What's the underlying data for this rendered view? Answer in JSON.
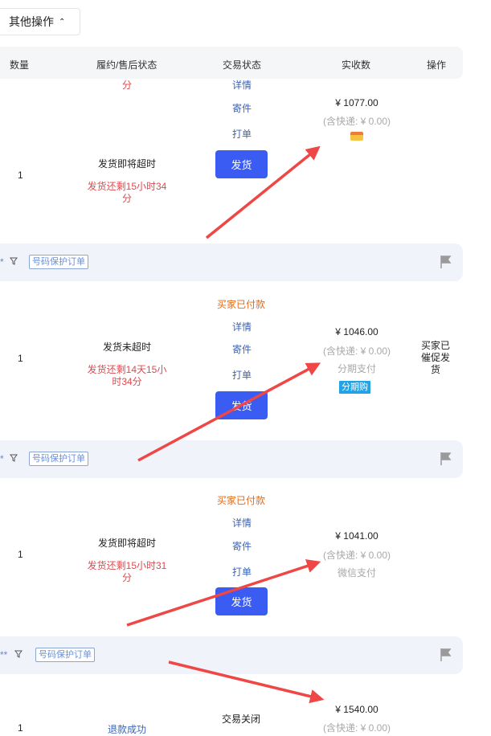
{
  "toolbar": {
    "other_ops_label": "其他操作",
    "caret": "⌃"
  },
  "table_header": {
    "quantity": "数量",
    "fulfillment_status": "履约/售后状态",
    "trade_status": "交易状态",
    "paid_amount": "实收数",
    "actions": "操作"
  },
  "links": {
    "detail": "详情",
    "send": "寄件",
    "print": "打单"
  },
  "ship_label": "发货",
  "order1": {
    "top_fragment": "分",
    "quantity": "1",
    "timeout_status": "发货即将超时",
    "remaining_line1": "发货还剩15小时34",
    "remaining_line2": "分",
    "price": "¥ 1077.00",
    "shipping_note": "(含快递: ¥ 0.00)"
  },
  "separator": {
    "star": "*",
    "tag": "号码保护订单",
    "star_double": "**"
  },
  "order2": {
    "buyer_paid": "买家已付款",
    "quantity": "1",
    "timeout_status": "发货未超时",
    "remaining_line1": "发货还剩14天15小",
    "remaining_line2": "时34分",
    "price": "¥ 1046.00",
    "shipping_note": "(含快递: ¥ 0.00)",
    "payment_method": "分期支付",
    "badge": "分期购",
    "action_line1": "买家已",
    "action_line2": "催促发",
    "action_line3": "货"
  },
  "order3": {
    "buyer_paid": "买家已付款",
    "quantity": "1",
    "timeout_status": "发货即将超时",
    "remaining_line1": "发货还剩15小时31",
    "remaining_line2": "分",
    "price": "¥ 1041.00",
    "shipping_note": "(含快递: ¥ 0.00)",
    "payment_method": "微信支付"
  },
  "order4": {
    "quantity": "1",
    "refund_status": "退款成功",
    "trade_closed": "交易关闭",
    "price": "¥ 1540.00",
    "shipping_note": "(含快递: ¥ 0.00)"
  },
  "colors": {
    "ship_button": "#3a5cf2",
    "warning_red": "#e0484d",
    "paid_orange": "#e36b1a",
    "link_blue": "#3b64b7",
    "annotation_arrow": "#ef4646"
  }
}
